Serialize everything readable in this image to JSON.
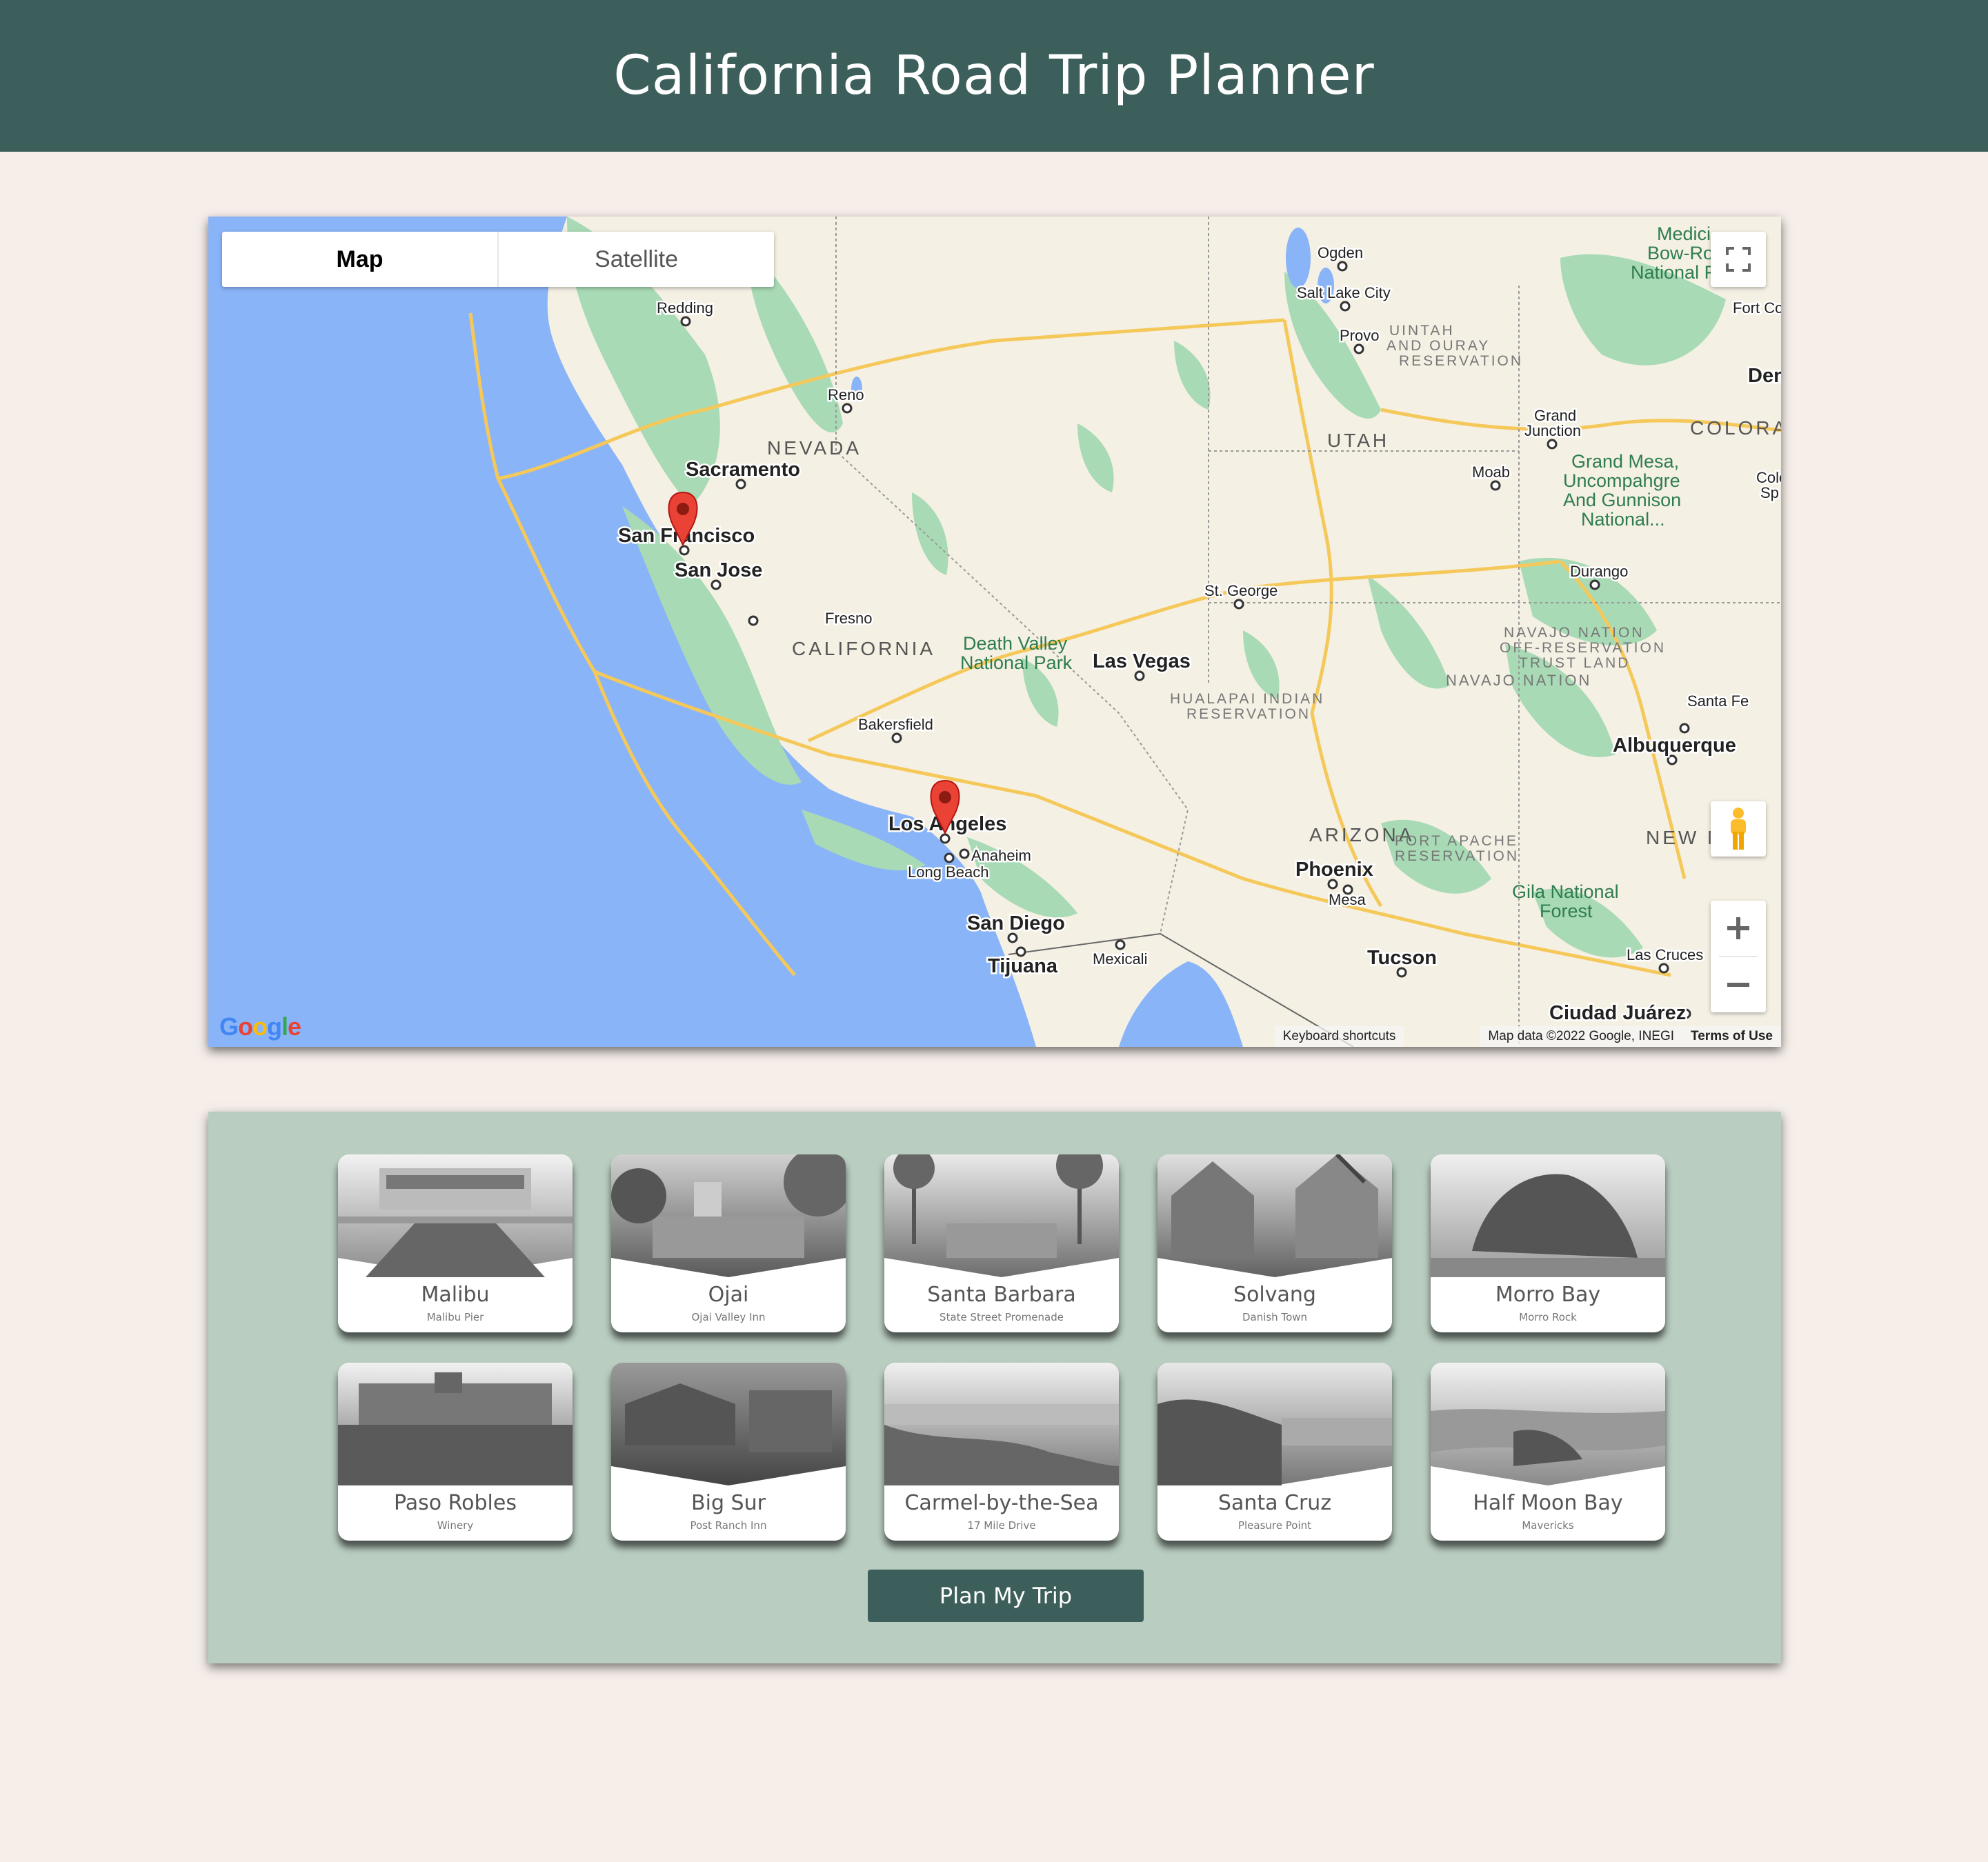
{
  "header": {
    "title": "California Road Trip Planner"
  },
  "map": {
    "map_type_tabs": [
      {
        "label": "Map",
        "active": true
      },
      {
        "label": "Satellite",
        "active": false
      }
    ],
    "region_labels": [
      "NEVADA",
      "UTAH",
      "CALIFORNIA",
      "ARIZONA",
      "COLORAD",
      "NEW M",
      "NAVAJO NATION",
      "UINTAH",
      "AND OURAY",
      "RESERVATION",
      "HUALAPAI INDIAN",
      "RESERVATION",
      "NAVAJO NATION",
      "OFF-RESERVATION",
      "TRUST LAND",
      "FORT APACHE",
      "RESERVATION"
    ],
    "park_labels": [
      "Death Valley",
      "National Park",
      "Grand Mesa,",
      "Uncompahgre",
      "And Gunnison",
      "National...",
      "Gila National",
      "Forest",
      "Medici",
      "Bow-Ro",
      "National F"
    ],
    "cities": [
      "Redding",
      "Reno",
      "Sacramento",
      "San Francisco",
      "San Jose",
      "Fresno",
      "Bakersfield",
      "Los Angeles",
      "Anaheim",
      "Long Beach",
      "San Diego",
      "Tijuana",
      "Mexicali",
      "Las Vegas",
      "St. George",
      "Ogden",
      "Salt Lake City",
      "Provo",
      "Grand",
      "Junction",
      "Moab",
      "Durango",
      "Santa Fe",
      "Albuquerque",
      "Phoenix",
      "Mesa",
      "Tucson",
      "Las Cruces",
      "Ciudad Juárez",
      "Den",
      "Fort Co",
      "Colo",
      "Sp"
    ],
    "markers": [
      "San Francisco",
      "Los Angeles"
    ],
    "google_logo": "Google",
    "attribution": {
      "shortcuts": "Keyboard shortcuts",
      "data": "Map data ©2022 Google, INEGI",
      "terms": "Terms of Use"
    },
    "controls": {
      "fullscreen_icon": "fullscreen-icon",
      "pegman_icon": "pegman-icon",
      "zoom_in": "+",
      "zoom_out": "−"
    }
  },
  "cards": [
    {
      "name": "Malibu",
      "sub": "Malibu Pier",
      "icon": "pier-photo"
    },
    {
      "name": "Ojai",
      "sub": "Ojai Valley Inn",
      "icon": "inn-photo"
    },
    {
      "name": "Santa Barbara",
      "sub": "State Street Promenade",
      "icon": "street-photo"
    },
    {
      "name": "Solvang",
      "sub": "Danish Town",
      "icon": "town-photo"
    },
    {
      "name": "Morro Bay",
      "sub": "Morro Rock",
      "icon": "rock-photo"
    },
    {
      "name": "Paso Robles",
      "sub": "Winery",
      "icon": "winery-photo"
    },
    {
      "name": "Big Sur",
      "sub": "Post Ranch Inn",
      "icon": "ranch-photo"
    },
    {
      "name": "Carmel-by-the-Sea",
      "sub": "17 Mile Drive",
      "icon": "coast-drive-photo"
    },
    {
      "name": "Santa Cruz",
      "sub": "Pleasure Point",
      "icon": "beach-photo"
    },
    {
      "name": "Half Moon Bay",
      "sub": "Mavericks",
      "icon": "bay-photo"
    }
  ],
  "plan_button": "Plan My Trip",
  "colors": {
    "header": "#3c5f5b",
    "page_bg": "#f6eee9",
    "panel_bg": "#b9cdc0",
    "button": "#3c5f5b",
    "ocean": "#8ab4f8",
    "land": "#f5f0e4",
    "park": "#a8dab5",
    "marker": "#ea4335"
  }
}
